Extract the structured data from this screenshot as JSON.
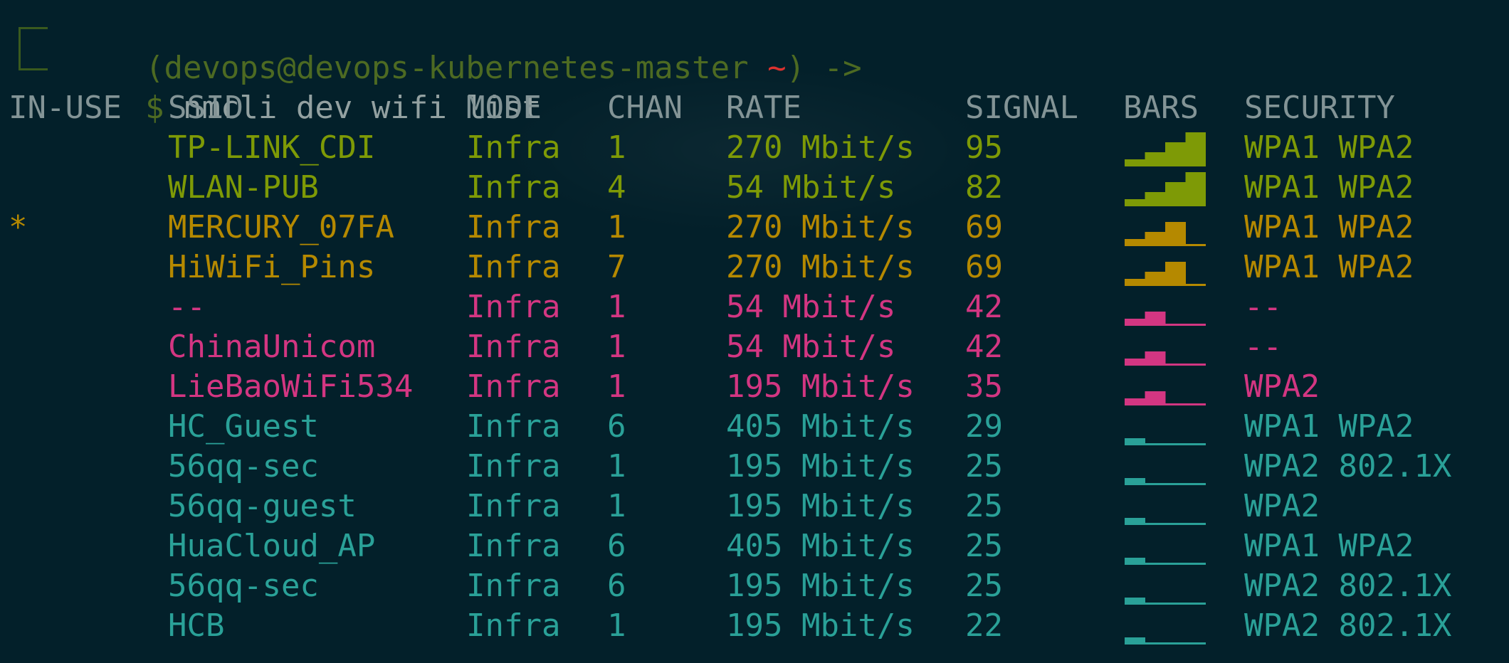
{
  "terminal": {
    "prompt_user": "(devops@devops-kubernetes-master ",
    "prompt_tilde": "~",
    "prompt_suffix": ") ->",
    "prompt_dollar": "$",
    "command": "nmcli dev wifi list"
  },
  "table": {
    "headers": {
      "in_use": "IN-USE",
      "ssid": "SSID",
      "mode": "MODE",
      "chan": "CHAN",
      "rate": "RATE",
      "signal": "SIGNAL",
      "bars": "BARS",
      "security": "SECURITY"
    },
    "rows": [
      {
        "in_use": "",
        "ssid": "TP-LINK_CDI",
        "mode": "Infra",
        "chan": "1",
        "rate": "270 Mbit/s",
        "signal": "95",
        "bars": 4,
        "security": "WPA1 WPA2",
        "color": "#7e9a06"
      },
      {
        "in_use": "",
        "ssid": "WLAN-PUB",
        "mode": "Infra",
        "chan": "4",
        "rate": "54 Mbit/s",
        "signal": "82",
        "bars": 4,
        "security": "WPA1 WPA2",
        "color": "#7e9a06"
      },
      {
        "in_use": "*",
        "ssid": "MERCURY_07FA",
        "mode": "Infra",
        "chan": "1",
        "rate": "270 Mbit/s",
        "signal": "69",
        "bars": 3,
        "security": "WPA1 WPA2",
        "color": "#b58900"
      },
      {
        "in_use": "",
        "ssid": "HiWiFi_Pins",
        "mode": "Infra",
        "chan": "7",
        "rate": "270 Mbit/s",
        "signal": "69",
        "bars": 3,
        "security": "WPA1 WPA2",
        "color": "#b58900"
      },
      {
        "in_use": "",
        "ssid": "--",
        "mode": "Infra",
        "chan": "1",
        "rate": "54 Mbit/s",
        "signal": "42",
        "bars": 2,
        "security": "--",
        "color": "#d33682"
      },
      {
        "in_use": "",
        "ssid": "ChinaUnicom",
        "mode": "Infra",
        "chan": "1",
        "rate": "54 Mbit/s",
        "signal": "42",
        "bars": 2,
        "security": "--",
        "color": "#d33682"
      },
      {
        "in_use": "",
        "ssid": "LieBaoWiFi534",
        "mode": "Infra",
        "chan": "1",
        "rate": "195 Mbit/s",
        "signal": "35",
        "bars": 2,
        "security": "WPA2",
        "color": "#d33682"
      },
      {
        "in_use": "",
        "ssid": "HC_Guest",
        "mode": "Infra",
        "chan": "6",
        "rate": "405 Mbit/s",
        "signal": "29",
        "bars": 1,
        "security": "WPA1 WPA2",
        "color": "#2aa198"
      },
      {
        "in_use": "",
        "ssid": "56qq-sec",
        "mode": "Infra",
        "chan": "1",
        "rate": "195 Mbit/s",
        "signal": "25",
        "bars": 1,
        "security": "WPA2 802.1X",
        "color": "#2aa198"
      },
      {
        "in_use": "",
        "ssid": "56qq-guest",
        "mode": "Infra",
        "chan": "1",
        "rate": "195 Mbit/s",
        "signal": "25",
        "bars": 1,
        "security": "WPA2",
        "color": "#2aa198"
      },
      {
        "in_use": "",
        "ssid": "HuaCloud_AP",
        "mode": "Infra",
        "chan": "6",
        "rate": "405 Mbit/s",
        "signal": "25",
        "bars": 1,
        "security": "WPA1 WPA2",
        "color": "#2aa198"
      },
      {
        "in_use": "",
        "ssid": "56qq-sec",
        "mode": "Infra",
        "chan": "6",
        "rate": "195 Mbit/s",
        "signal": "25",
        "bars": 1,
        "security": "WPA2 802.1X",
        "color": "#2aa198"
      },
      {
        "in_use": "",
        "ssid": "HCB",
        "mode": "Infra",
        "chan": "1",
        "rate": "195 Mbit/s",
        "signal": "22",
        "bars": 1,
        "security": "WPA2 802.1X",
        "color": "#2aa198"
      }
    ]
  },
  "colors": {
    "background": "#03202a",
    "header_text": "#839496",
    "prompt_green": "#4d6a22",
    "prompt_red": "#dc322f",
    "command_text": "#93a1a1"
  }
}
